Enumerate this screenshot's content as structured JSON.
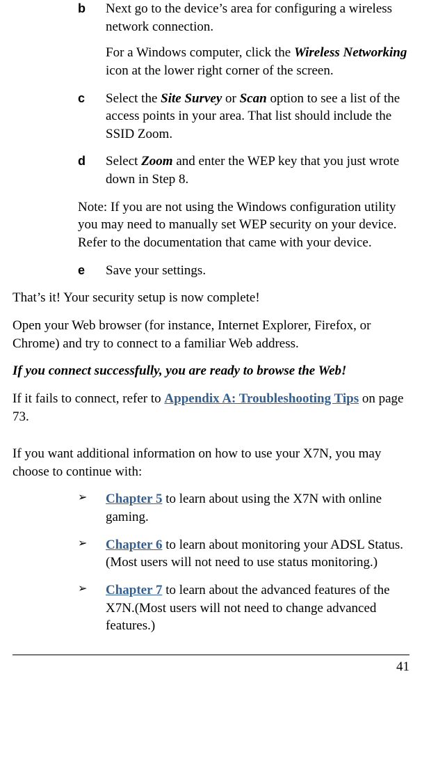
{
  "steps": {
    "b": {
      "label": "b",
      "text1_a": "Next go to the device’s area for configuring a wireless network connection.",
      "text2_a": "For a Windows computer, click the ",
      "text2_bold": "Wireless Networking",
      "text2_b": " icon at the lower right corner of the screen."
    },
    "c": {
      "label": "c",
      "t1": "Select the ",
      "b1": "Site Survey",
      "t2": " or ",
      "b2": "Scan",
      "t3": " option to see a list of the access points in your area. That list should include the SSID Zoom."
    },
    "d": {
      "label": "d",
      "t1": "Select ",
      "b1": "Zoom",
      "t2": " and enter the WEP key that you just wrote down in Step 8."
    },
    "note": "Note:  If you are not using the Windows configuration utility you may need to manually set WEP security on your device.  Refer to the documentation that came with your device.",
    "e": {
      "label": "e",
      "t": "Save your settings."
    }
  },
  "done": "That’s it! Your security setup is now complete!",
  "open_browser": "Open your Web browser (for instance, Internet Explorer, Firefox, or Chrome) and try to connect to a familiar Web address.",
  "success": "If you connect successfully, you are ready to browse the Web!",
  "fail_a": "If it fails to connect, refer to ",
  "fail_link": "Appendix A: Troubleshooting Tips",
  "fail_b": " on page 73.",
  "more_info": "If you want additional information on how to use your X7N, you may choose to continue with:",
  "bullets": [
    {
      "link": "Chapter 5",
      "rest": " to learn about using the X7N with online gaming."
    },
    {
      "link": "Chapter 6",
      "rest": " to learn about monitoring your ADSL Status. (Most users will not need to use status monitoring.)"
    },
    {
      "link": "Chapter 7",
      "rest": " to learn about the advanced features of the X7N.(Most users will not need to change advanced features.)"
    }
  ],
  "bullet_mark": "➢",
  "page_number": "41"
}
